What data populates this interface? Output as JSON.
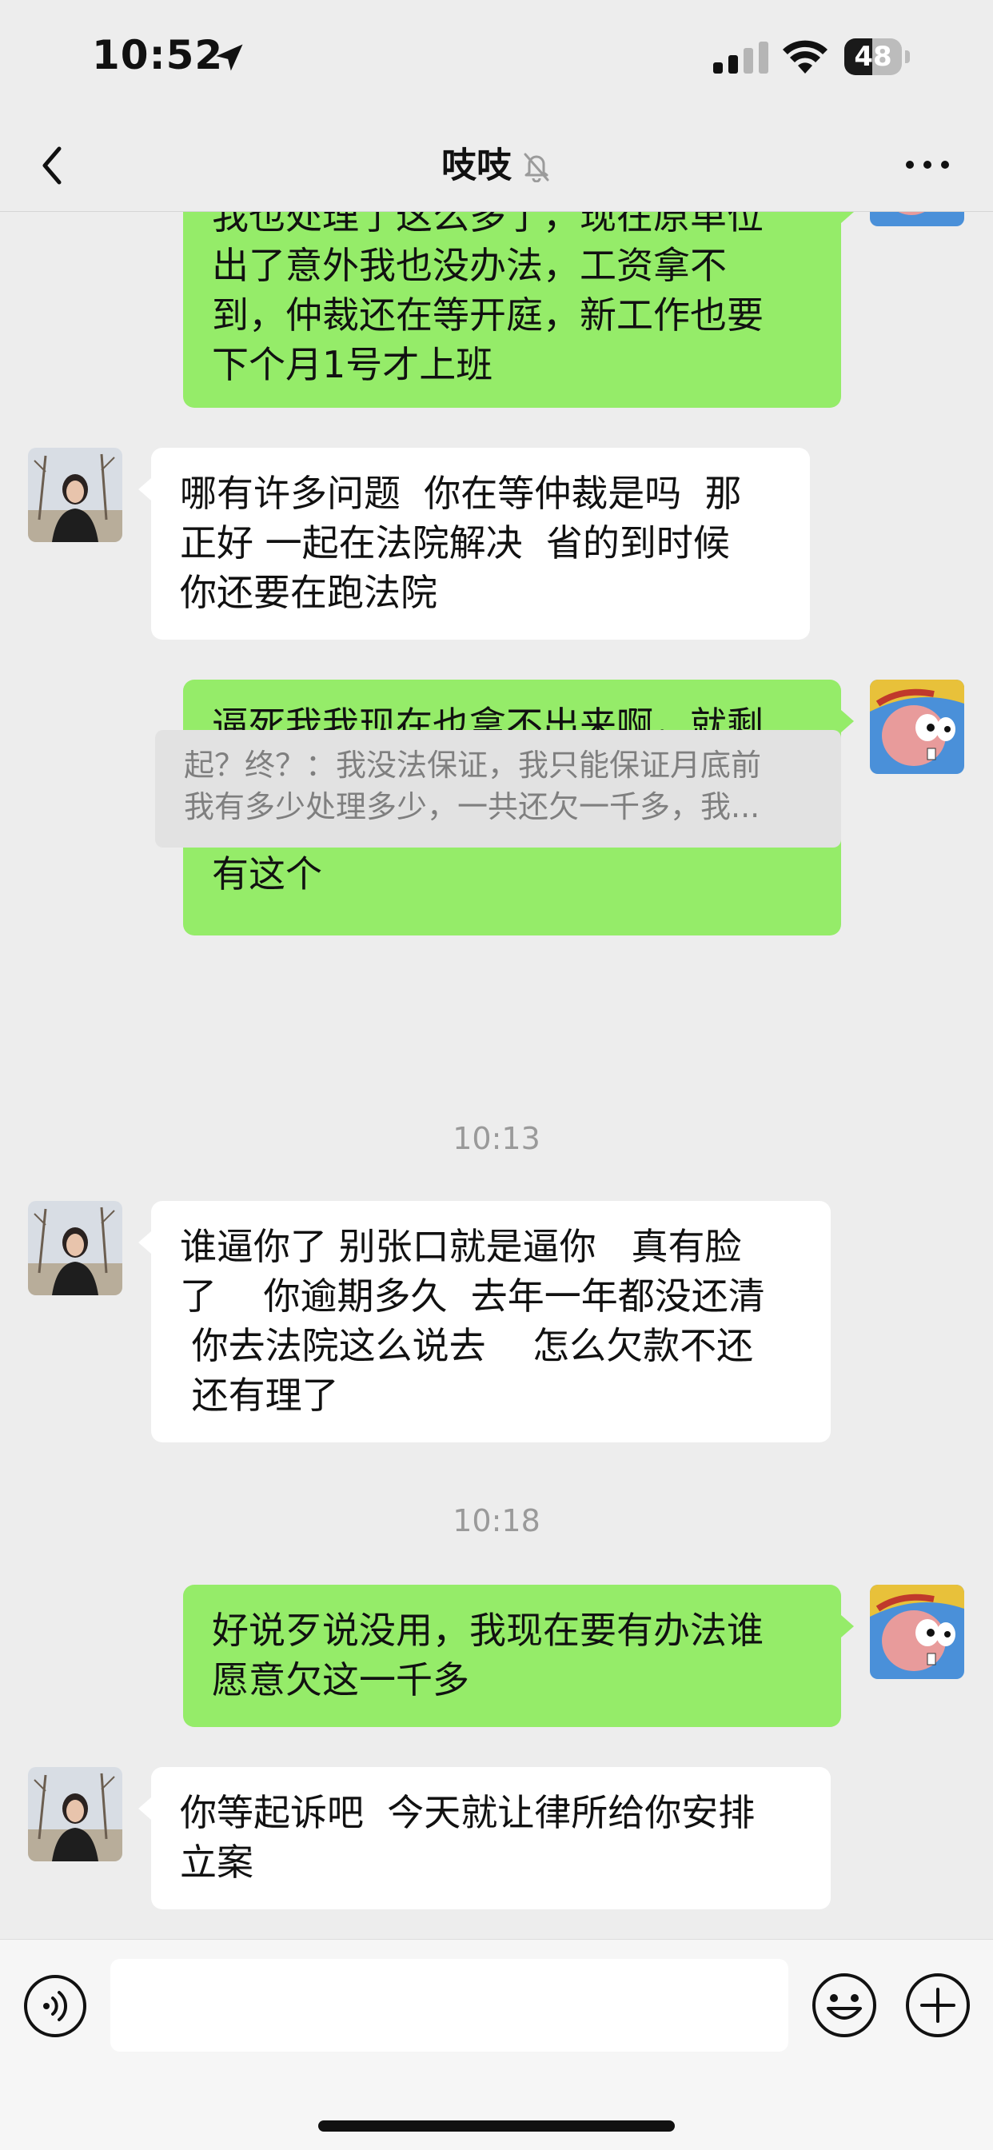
{
  "status_bar": {
    "time": "10:52",
    "battery_percent": "48",
    "battery_level": 0.48
  },
  "header": {
    "title": "吱吱"
  },
  "messages": [
    {
      "side": "out",
      "text": "我也处理了这么多了，现在原单位\n出了意外我也没办法，工资拿不\n到，仲裁还在等开庭，新工作也要\n下个月1号才上班"
    },
    {
      "side": "in",
      "text": "哪有许多问题  你在等仲裁是吗  那\n正好 一起在法院解决  省的到时候\n你还要在跑法院"
    },
    {
      "side": "out",
      "text": "逼死我我现在也拿不出来啊，就剩\n一千多了非要逼死人我也没办法，\n我现在变不出这么多，我能做的只\n有这个"
    },
    {
      "side": "in",
      "text": "谁逼你了 别张口就是逼你   真有脸\n了    你逾期多久  去年一年都没还清\n 你去法院这么说去    怎么欠款不还\n 还有理了"
    },
    {
      "side": "out",
      "text": "好说歹说没用，我现在要有办法谁\n愿意欠这一千多"
    },
    {
      "side": "in",
      "text": "你等起诉吧  今天就让律所给你安排\n立案"
    }
  ],
  "quote": {
    "text": "起？终？：我没法保证，我只能保证月底前\n我有多少处理多少，一共还欠一千多，我..."
  },
  "timestamps": [
    "10:13",
    "10:18"
  ],
  "input": {
    "value": "",
    "placeholder": ""
  },
  "colors": {
    "bubble_out": "#95ec69",
    "bubble_in": "#ffffff",
    "background": "#ededed"
  }
}
